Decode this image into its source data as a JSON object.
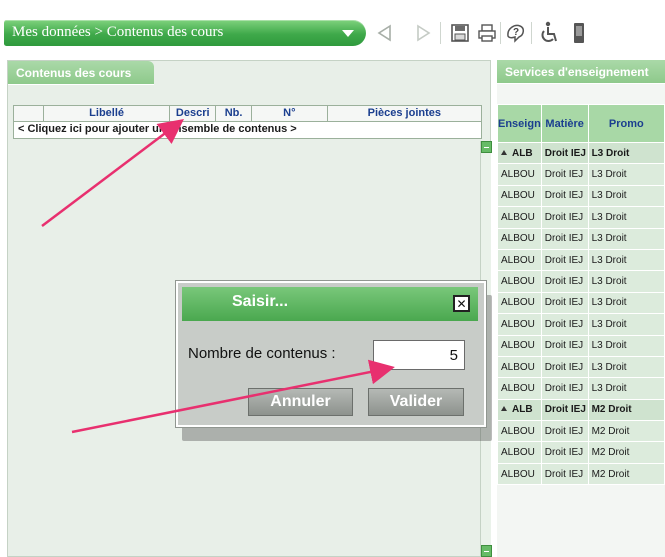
{
  "toolbar": {
    "breadcrumb": "Mes données > Contenus des cours"
  },
  "left_panel": {
    "title": "Contenus des cours",
    "columns": [
      "Libellé",
      "Descri",
      "Nb.",
      "N°",
      "Pièces jointes"
    ],
    "add_row": "< Cliquez ici pour ajouter un ensemble de contenus >"
  },
  "right_panel": {
    "title": "Services d'enseignement",
    "columns": [
      "Enseign",
      "Matière",
      "Promo"
    ],
    "rows": [
      {
        "teacher": "ALB",
        "subject": "Droit IEJ",
        "promo": "L3 Droit",
        "group": true
      },
      {
        "teacher": "ALBOU",
        "subject": "Droit IEJ",
        "promo": "L3 Droit"
      },
      {
        "teacher": "ALBOU",
        "subject": "Droit IEJ",
        "promo": "L3 Droit"
      },
      {
        "teacher": "ALBOU",
        "subject": "Droit IEJ",
        "promo": "L3 Droit"
      },
      {
        "teacher": "ALBOU",
        "subject": "Droit IEJ",
        "promo": "L3 Droit"
      },
      {
        "teacher": "ALBOU",
        "subject": "Droit IEJ",
        "promo": "L3 Droit"
      },
      {
        "teacher": "ALBOU",
        "subject": "Droit IEJ",
        "promo": "L3 Droit"
      },
      {
        "teacher": "ALBOU",
        "subject": "Droit IEJ",
        "promo": "L3 Droit"
      },
      {
        "teacher": "ALBOU",
        "subject": "Droit IEJ",
        "promo": "L3 Droit"
      },
      {
        "teacher": "ALBOU",
        "subject": "Droit IEJ",
        "promo": "L3 Droit"
      },
      {
        "teacher": "ALBOU",
        "subject": "Droit IEJ",
        "promo": "L3 Droit"
      },
      {
        "teacher": "ALBOU",
        "subject": "Droit IEJ",
        "promo": "L3 Droit"
      },
      {
        "teacher": "ALB",
        "subject": "Droit IEJ",
        "promo": "M2 Droit",
        "group": true
      },
      {
        "teacher": "ALBOU",
        "subject": "Droit IEJ",
        "promo": "M2 Droit"
      },
      {
        "teacher": "ALBOU",
        "subject": "Droit IEJ",
        "promo": "M2 Droit"
      },
      {
        "teacher": "ALBOU",
        "subject": "Droit IEJ",
        "promo": "M2 Droit"
      }
    ]
  },
  "dialog": {
    "title": "Saisir...",
    "field_label": "Nombre de contenus :",
    "field_value": "5",
    "cancel_label": "Annuler",
    "ok_label": "Valider",
    "close_glyph": "✕"
  },
  "colors": {
    "accent_green": "#4aa84f",
    "header_blue": "#1b3f8f",
    "arrow_pink": "#e8306f"
  }
}
